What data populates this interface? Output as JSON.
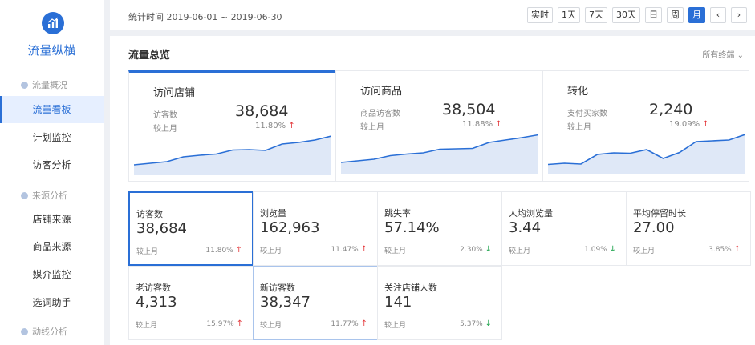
{
  "sidebar": {
    "brand": "流量纵横",
    "groups": [
      {
        "label": "流量概况",
        "items": [
          "流量看板",
          "计划监控",
          "访客分析"
        ]
      },
      {
        "label": "来源分析",
        "items": [
          "店铺来源",
          "商品来源",
          "媒介监控",
          "选词助手"
        ]
      },
      {
        "label": "动线分析",
        "items": []
      }
    ],
    "active": "流量看板"
  },
  "topbar": {
    "period": "统计时间 2019-06-01 ~ 2019-06-30",
    "buttons": [
      "实时",
      "1天",
      "7天",
      "30天",
      "日",
      "周",
      "月"
    ],
    "active": "月",
    "prev": "‹",
    "next": "›"
  },
  "panel": {
    "title": "流量总览",
    "terminal": "所有终端"
  },
  "overview_cards": [
    {
      "title": "访问店铺",
      "label": "访客数",
      "value": "38,684",
      "cmp": "较上月",
      "pct": "11.80%",
      "trend": "up",
      "spark": [
        0.82,
        0.78,
        0.74,
        0.62,
        0.58,
        0.55,
        0.45,
        0.44,
        0.46,
        0.3,
        0.26,
        0.2,
        0.1
      ]
    },
    {
      "title": "访问商品",
      "label": "商品访客数",
      "value": "38,504",
      "cmp": "较上月",
      "pct": "11.88%",
      "trend": "up",
      "spark": [
        0.8,
        0.76,
        0.72,
        0.63,
        0.59,
        0.56,
        0.47,
        0.46,
        0.45,
        0.3,
        0.24,
        0.18,
        0.11
      ]
    },
    {
      "title": "转化",
      "label": "支付买家数",
      "value": "2,240",
      "cmp": "较上月",
      "pct": "19.09%",
      "trend": "up",
      "spark": [
        0.85,
        0.82,
        0.84,
        0.6,
        0.56,
        0.57,
        0.48,
        0.7,
        0.55,
        0.28,
        0.26,
        0.24,
        0.1
      ]
    }
  ],
  "metrics": [
    {
      "title": "访客数",
      "value": "38,684",
      "cmp": "较上月",
      "pct": "11.80%",
      "trend": "up"
    },
    {
      "title": "浏览量",
      "value": "162,963",
      "cmp": "较上月",
      "pct": "11.47%",
      "trend": "up"
    },
    {
      "title": "跳失率",
      "value": "57.14%",
      "cmp": "较上月",
      "pct": "2.30%",
      "trend": "down"
    },
    {
      "title": "人均浏览量",
      "value": "3.44",
      "cmp": "较上月",
      "pct": "1.09%",
      "trend": "down"
    },
    {
      "title": "平均停留时长",
      "value": "27.00",
      "cmp": "较上月",
      "pct": "3.85%",
      "trend": "up"
    },
    {
      "title": "老访客数",
      "value": "4,313",
      "cmp": "较上月",
      "pct": "15.97%",
      "trend": "up"
    },
    {
      "title": "新访客数",
      "value": "38,347",
      "cmp": "较上月",
      "pct": "11.77%",
      "trend": "up"
    },
    {
      "title": "关注店铺人数",
      "value": "141",
      "cmp": "较上月",
      "pct": "5.37%",
      "trend": "down"
    }
  ],
  "icons": {
    "up": "↑",
    "down": "↓",
    "chevron_down": "⌄"
  },
  "colors": {
    "accent": "#2a6fd6",
    "up": "#e4393c",
    "down": "#1aa34a"
  }
}
